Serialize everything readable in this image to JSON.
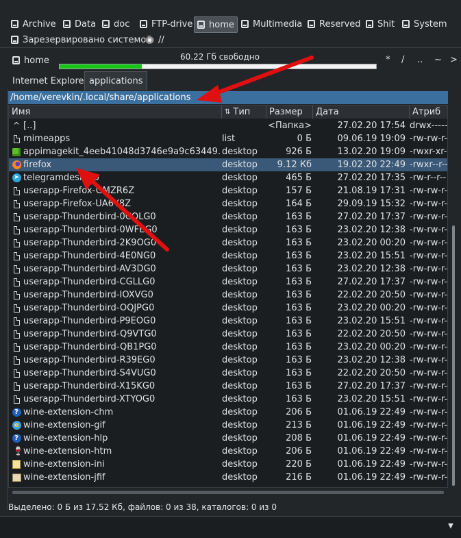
{
  "drives": [
    {
      "label": "Archive",
      "active": false
    },
    {
      "label": "Data",
      "active": false
    },
    {
      "label": "doc",
      "active": false
    },
    {
      "label": "FTP-drive",
      "active": false
    },
    {
      "label": "home",
      "active": true
    },
    {
      "label": "Multimedia",
      "active": false
    },
    {
      "label": "Reserved",
      "active": false
    },
    {
      "label": "Shit",
      "active": false
    },
    {
      "label": "System",
      "active": false
    },
    {
      "label": "Зарезервировано системой",
      "active": false
    },
    {
      "label": "//",
      "active": false
    }
  ],
  "current_drive": {
    "name": "home",
    "free_text": "60.22 Гб свободно",
    "used_fraction": 0.26,
    "nav": {
      "root": "*",
      "slash": "/",
      "up": "..",
      "home": "~",
      "next": ">"
    }
  },
  "tabs": [
    {
      "label": "Internet Explorer",
      "active": false
    },
    {
      "label": "applications",
      "active": true
    }
  ],
  "path": "/home/verevkin/.local/share/applications",
  "columns": {
    "name": "Имя",
    "ext": "Тип",
    "size": "Размер",
    "date": "Дата",
    "attr": "Атриб"
  },
  "files": [
    {
      "icon": "up-icon",
      "name": "[..]",
      "ext": "",
      "size": "<Папка>",
      "date": "27.02.20 17:54",
      "attr": "drwx------",
      "selected": false
    },
    {
      "icon": "file-icon",
      "name": "mimeapps",
      "ext": "list",
      "size": "0 Б",
      "date": "09.06.19 19:09",
      "attr": "-rw-rw-r--",
      "selected": false
    },
    {
      "icon": "appimage-icon",
      "name": "appimagekit_4eeb41048d3746e9a9c63449...",
      "ext": "desktop",
      "size": "926 Б",
      "date": "13.02.20 19:09",
      "attr": "-rwxr-xr-x",
      "selected": false
    },
    {
      "icon": "firefox-icon",
      "name": "firefox",
      "ext": "desktop",
      "size": "9.12 Кб",
      "date": "19.02.20 22:49",
      "attr": "-rwxr--r--",
      "selected": true
    },
    {
      "icon": "telegram-icon",
      "name": "telegramdesktop",
      "ext": "desktop",
      "size": "465 Б",
      "date": "27.02.20 17:35",
      "attr": "-rw-r--r--",
      "selected": false
    },
    {
      "icon": "file-icon",
      "name": "userapp-Firefox-GMZR6Z",
      "ext": "desktop",
      "size": "157 Б",
      "date": "21.08.19 17:31",
      "attr": "-rw-rw-r--",
      "selected": false
    },
    {
      "icon": "file-icon",
      "name": "userapp-Firefox-UA6Y8Z",
      "ext": "desktop",
      "size": "164 Б",
      "date": "29.09.19 15:32",
      "attr": "-rw-rw-r--",
      "selected": false
    },
    {
      "icon": "file-icon",
      "name": "userapp-Thunderbird-0CQLG0",
      "ext": "desktop",
      "size": "163 Б",
      "date": "27.02.20 17:37",
      "attr": "-rw-rw-r--",
      "selected": false
    },
    {
      "icon": "file-icon",
      "name": "userapp-Thunderbird-0WFEG0",
      "ext": "desktop",
      "size": "163 Б",
      "date": "23.02.20 12:38",
      "attr": "-rw-rw-r--",
      "selected": false
    },
    {
      "icon": "file-icon",
      "name": "userapp-Thunderbird-2K9OG0",
      "ext": "desktop",
      "size": "163 Б",
      "date": "23.02.20 00:20",
      "attr": "-rw-rw-r--",
      "selected": false
    },
    {
      "icon": "file-icon",
      "name": "userapp-Thunderbird-4E0NG0",
      "ext": "desktop",
      "size": "163 Б",
      "date": "23.02.20 15:51",
      "attr": "-rw-rw-r--",
      "selected": false
    },
    {
      "icon": "file-icon",
      "name": "userapp-Thunderbird-AV3DG0",
      "ext": "desktop",
      "size": "163 Б",
      "date": "23.02.20 12:38",
      "attr": "-rw-rw-r--",
      "selected": false
    },
    {
      "icon": "file-icon",
      "name": "userapp-Thunderbird-CGLLG0",
      "ext": "desktop",
      "size": "163 Б",
      "date": "27.02.20 17:37",
      "attr": "-rw-rw-r--",
      "selected": false
    },
    {
      "icon": "file-icon",
      "name": "userapp-Thunderbird-IOXVG0",
      "ext": "desktop",
      "size": "163 Б",
      "date": "22.02.20 20:50",
      "attr": "-rw-rw-r--",
      "selected": false
    },
    {
      "icon": "file-icon",
      "name": "userapp-Thunderbird-OQJPG0",
      "ext": "desktop",
      "size": "163 Б",
      "date": "23.02.20 00:20",
      "attr": "-rw-rw-r--",
      "selected": false
    },
    {
      "icon": "file-icon",
      "name": "userapp-Thunderbird-P9EOG0",
      "ext": "desktop",
      "size": "163 Б",
      "date": "23.02.20 15:51",
      "attr": "-rw-rw-r--",
      "selected": false
    },
    {
      "icon": "file-icon",
      "name": "userapp-Thunderbird-Q9VTG0",
      "ext": "desktop",
      "size": "163 Б",
      "date": "22.02.20 20:50",
      "attr": "-rw-rw-r--",
      "selected": false
    },
    {
      "icon": "file-icon",
      "name": "userapp-Thunderbird-QB1PG0",
      "ext": "desktop",
      "size": "163 Б",
      "date": "23.02.20 00:20",
      "attr": "-rw-rw-r--",
      "selected": false
    },
    {
      "icon": "file-icon",
      "name": "userapp-Thunderbird-R39EG0",
      "ext": "desktop",
      "size": "163 Б",
      "date": "23.02.20 12:38",
      "attr": "-rw-rw-r--",
      "selected": false
    },
    {
      "icon": "file-icon",
      "name": "userapp-Thunderbird-S4VUG0",
      "ext": "desktop",
      "size": "163 Б",
      "date": "22.02.20 20:50",
      "attr": "-rw-rw-r--",
      "selected": false
    },
    {
      "icon": "file-icon",
      "name": "userapp-Thunderbird-X15KG0",
      "ext": "desktop",
      "size": "163 Б",
      "date": "27.02.20 17:37",
      "attr": "-rw-rw-r--",
      "selected": false
    },
    {
      "icon": "file-icon",
      "name": "userapp-Thunderbird-XTYOG0",
      "ext": "desktop",
      "size": "163 Б",
      "date": "23.02.20 15:51",
      "attr": "-rw-rw-r--",
      "selected": false
    },
    {
      "icon": "help-icon",
      "name": "wine-extension-chm",
      "ext": "desktop",
      "size": "206 Б",
      "date": "01.06.19 22:49",
      "attr": "-rw-rw-r--",
      "selected": false
    },
    {
      "icon": "ie-icon",
      "name": "wine-extension-gif",
      "ext": "desktop",
      "size": "213 Б",
      "date": "01.06.19 22:49",
      "attr": "-rw-rw-r--",
      "selected": false
    },
    {
      "icon": "help-icon",
      "name": "wine-extension-hlp",
      "ext": "desktop",
      "size": "208 Б",
      "date": "01.06.19 22:49",
      "attr": "-rw-rw-r--",
      "selected": false
    },
    {
      "icon": "wine-icon",
      "name": "wine-extension-htm",
      "ext": "desktop",
      "size": "206 Б",
      "date": "01.06.19 22:49",
      "attr": "-rw-rw-r--",
      "selected": false
    },
    {
      "icon": "notepad-icon",
      "name": "wine-extension-ini",
      "ext": "desktop",
      "size": "220 Б",
      "date": "01.06.19 22:49",
      "attr": "-rw-rw-r--",
      "selected": false
    },
    {
      "icon": "image-icon",
      "name": "wine-extension-jfif",
      "ext": "desktop",
      "size": "216 Б",
      "date": "01.06.19 22:49",
      "attr": "-rw-rw-r--",
      "selected": false
    }
  ],
  "status": "Выделено: 0 Б из 17.52 Кб, файлов: 0 из 38, каталогов: 0 из 0",
  "colors": {
    "background": "#232629",
    "selection": "#3a5877",
    "path_bar": "#3a6f9e",
    "free_space_bar": "#17c617",
    "annotation_arrow": "#e01010"
  }
}
